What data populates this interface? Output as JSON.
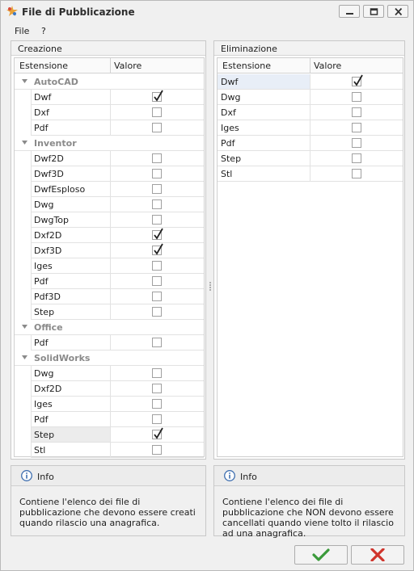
{
  "window": {
    "title": "File di Pubblicazione"
  },
  "menu": {
    "file": "File",
    "help": "?"
  },
  "left": {
    "title": "Creazione",
    "columns": {
      "ext": "Estensione",
      "value": "Valore"
    },
    "groups": [
      {
        "name": "AutoCAD",
        "items": [
          {
            "ext": "Dwf",
            "checked": true
          },
          {
            "ext": "Dxf",
            "checked": false
          },
          {
            "ext": "Pdf",
            "checked": false
          }
        ]
      },
      {
        "name": "Inventor",
        "items": [
          {
            "ext": "Dwf2D",
            "checked": false
          },
          {
            "ext": "Dwf3D",
            "checked": false
          },
          {
            "ext": "DwfEsploso",
            "checked": false
          },
          {
            "ext": "Dwg",
            "checked": false
          },
          {
            "ext": "DwgTop",
            "checked": false
          },
          {
            "ext": "Dxf2D",
            "checked": true
          },
          {
            "ext": "Dxf3D",
            "checked": true
          },
          {
            "ext": "Iges",
            "checked": false
          },
          {
            "ext": "Pdf",
            "checked": false
          },
          {
            "ext": "Pdf3D",
            "checked": false
          },
          {
            "ext": "Step",
            "checked": false
          }
        ]
      },
      {
        "name": "Office",
        "items": [
          {
            "ext": "Pdf",
            "checked": false
          }
        ]
      },
      {
        "name": "SolidWorks",
        "items": [
          {
            "ext": "Dwg",
            "checked": false
          },
          {
            "ext": "Dxf2D",
            "checked": false
          },
          {
            "ext": "Iges",
            "checked": false
          },
          {
            "ext": "Pdf",
            "checked": false
          },
          {
            "ext": "Step",
            "checked": true
          },
          {
            "ext": "Stl",
            "checked": false
          }
        ]
      }
    ],
    "info": {
      "title": "Info",
      "text": "Contiene l'elenco dei file di pubblicazione che devono essere creati quando rilascio una anagrafica."
    }
  },
  "right": {
    "title": "Eliminazione",
    "columns": {
      "ext": "Estensione",
      "value": "Valore"
    },
    "items": [
      {
        "ext": "Dwf",
        "checked": true,
        "selected": true
      },
      {
        "ext": "Dwg",
        "checked": false
      },
      {
        "ext": "Dxf",
        "checked": false
      },
      {
        "ext": "Iges",
        "checked": false
      },
      {
        "ext": "Pdf",
        "checked": false
      },
      {
        "ext": "Step",
        "checked": false
      },
      {
        "ext": "Stl",
        "checked": false
      }
    ],
    "info": {
      "title": "Info",
      "text": "Contiene l'elenco dei file di pubblicazione che NON devono essere cancellati quando viene tolto il rilascio ad una anagrafica."
    }
  },
  "colors": {
    "ok": "#3a9a3a",
    "cancel": "#d0342c",
    "selected_row": "#e8eef7",
    "selected_row_left": "#ececec"
  }
}
